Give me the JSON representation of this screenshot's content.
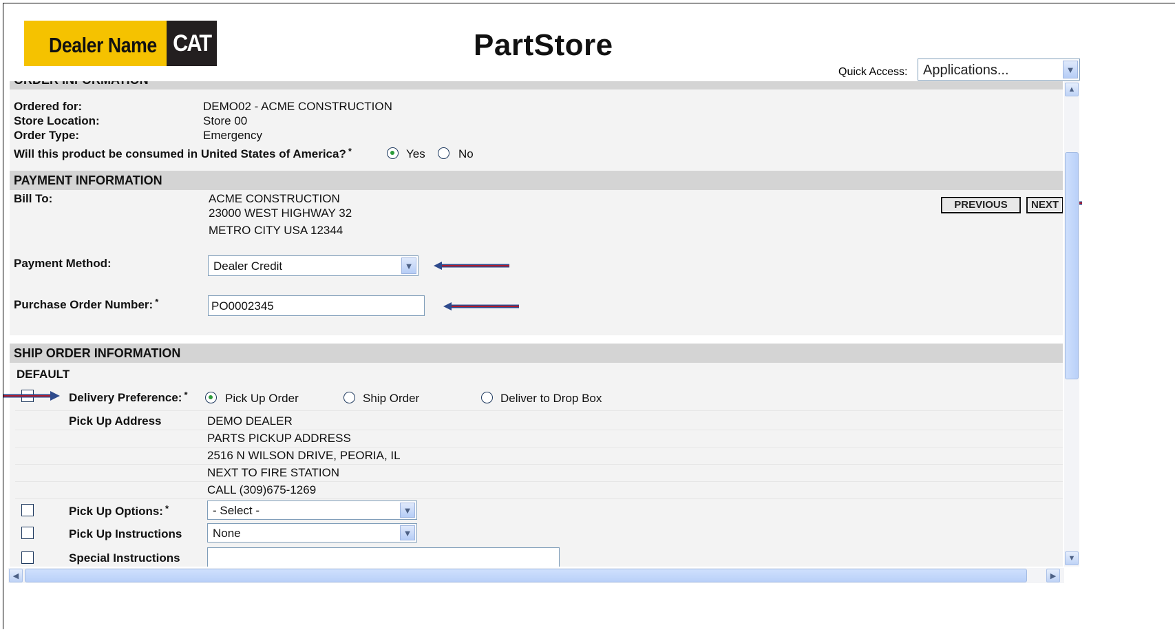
{
  "header": {
    "logo_text": "Dealer Name",
    "logo_brand": "CAT",
    "app_title": "PartStore",
    "quick_access_label": "Quick Access:",
    "quick_access_value": "Applications..."
  },
  "order_information": {
    "section_title": "ORDER INFORMATION",
    "ordered_for_label": "Ordered for:",
    "ordered_for_value": "DEMO02 - ACME CONSTRUCTION",
    "store_location_label": "Store Location:",
    "store_location_value": "Store 00",
    "order_type_label": "Order Type:",
    "order_type_value": "Emergency",
    "consumed_usa_label": "Will this product be consumed in United States of America?",
    "required_mark": "*",
    "yes_label": "Yes",
    "no_label": "No",
    "consumed_usa_selected": "Yes"
  },
  "payment_information": {
    "section_title": "PAYMENT INFORMATION",
    "bill_to_label": "Bill To:",
    "bill_to_lines": [
      "ACME CONSTRUCTION",
      "23000 WEST HIGHWAY 32",
      "METRO CITY USA 12344"
    ],
    "payment_method_label": "Payment Method:",
    "payment_method_value": "Dealer Credit",
    "po_number_label": "Purchase Order Number:",
    "required_mark": "*",
    "po_number_value": "PO0002345",
    "previous_label": "PREVIOUS",
    "next_label": "NEXT"
  },
  "ship_order_information": {
    "section_title": "SHIP ORDER INFORMATION",
    "subsection_title": "DEFAULT",
    "delivery_preference_label": "Delivery Preference:",
    "required_mark": "*",
    "delivery_options": [
      "Pick Up Order",
      "Ship Order",
      "Deliver to Drop Box"
    ],
    "delivery_selected": "Pick Up Order",
    "pickup_address_label": "Pick Up Address",
    "pickup_address_lines": [
      "DEMO DEALER",
      "PARTS PICKUP ADDRESS",
      "2516 N WILSON DRIVE, PEORIA, IL",
      "NEXT TO FIRE STATION",
      "CALL (309)675-1269"
    ],
    "pickup_options_label": "Pick Up Options:",
    "pickup_options_value": "- Select -",
    "pickup_instructions_label": "Pick Up Instructions",
    "pickup_instructions_value": "None",
    "special_instructions_label": "Special Instructions",
    "special_instructions_value": ""
  },
  "colors": {
    "logo_yellow": "#f5c200",
    "section_gray": "#d4d4d4",
    "content_bg": "#f3f3f3",
    "arrow_blue": "#2e4a8c",
    "arrow_red": "#b01c2e"
  },
  "icons": {
    "dropdown": "chevron-down-icon",
    "arrow": "annotation-arrow-icon",
    "scroll_up": "chevron-up-icon",
    "scroll_down": "chevron-down-icon",
    "scroll_left": "chevron-left-icon",
    "scroll_right": "chevron-right-icon"
  }
}
